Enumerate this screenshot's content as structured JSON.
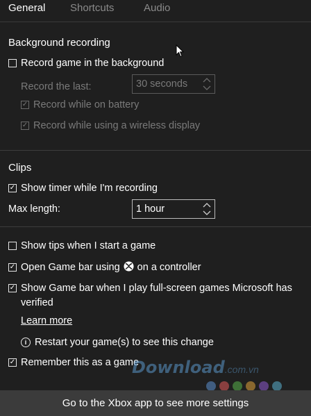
{
  "tabs": [
    {
      "label": "General",
      "active": true
    },
    {
      "label": "Shortcuts",
      "active": false
    },
    {
      "label": "Audio",
      "active": false
    }
  ],
  "background_recording": {
    "title": "Background recording",
    "record_in_background": {
      "label": "Record game in the background",
      "checked": false
    },
    "record_last": {
      "label": "Record the last:",
      "value": "30 seconds"
    },
    "record_on_battery": {
      "label": "Record while on battery",
      "checked": true
    },
    "record_wireless_display": {
      "label": "Record while using a wireless display",
      "checked": true
    }
  },
  "clips": {
    "title": "Clips",
    "show_timer": {
      "label": "Show timer while I'm recording",
      "checked": true
    },
    "max_length": {
      "label": "Max length:",
      "value": "1 hour"
    }
  },
  "general": {
    "show_tips": {
      "label": "Show tips when I start a game",
      "checked": false
    },
    "open_game_bar": {
      "label_before": "Open Game bar using",
      "label_after": "on a controller",
      "checked": true
    },
    "show_full_screen": {
      "label": "Show Game bar when I play full-screen games Microsoft has verified",
      "checked": true
    },
    "learn_more": "Learn more",
    "restart_info": "Restart your game(s) to see this change",
    "remember_game": {
      "label": "Remember this as a game",
      "checked": true
    }
  },
  "footer": {
    "label": "Go to the Xbox app to see more settings"
  },
  "watermark": {
    "text": "Download",
    "suffix": ".com.vn"
  },
  "icons": {
    "xbox": "xbox-logo-icon",
    "info": "info-icon",
    "check": "checkmark-icon",
    "cursor": "mouse-pointer-icon"
  },
  "colors": {
    "background": "#1f1f1f",
    "footer": "#3b3b3b",
    "text": "#ffffff",
    "disabled_text": "#7a7a7a",
    "divider": "#3d3d3d",
    "watermark_dots": [
      "#5b8fd0",
      "#e05a5a",
      "#58b34a",
      "#e0a23a",
      "#8e5ad0",
      "#5ab0d0"
    ]
  }
}
